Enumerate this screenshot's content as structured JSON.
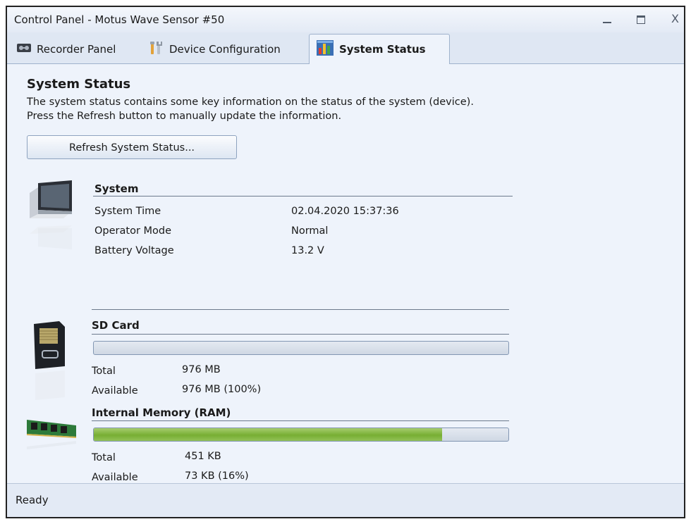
{
  "window": {
    "title": "Control Panel - Motus Wave Sensor #50"
  },
  "window_controls": {
    "minimize": "minimize",
    "maximize": "maximize",
    "close": "X"
  },
  "tabs": [
    {
      "label": "Recorder Panel",
      "icon": "recorder-icon"
    },
    {
      "label": "Device Configuration",
      "icon": "tools-icon"
    },
    {
      "label": "System Status",
      "icon": "system-status-icon",
      "active": true
    }
  ],
  "page": {
    "heading": "System Status",
    "description": [
      "The system status contains some key information on the status of the system (device).",
      "Press the Refresh button to manually update the information."
    ],
    "refresh_button": "Refresh System Status..."
  },
  "system": {
    "title": "System",
    "icon": "monitor-icon",
    "rows": [
      {
        "label": "System Time",
        "value": "02.04.2020 15:37:36"
      },
      {
        "label": "Operator Mode",
        "value": "Normal"
      },
      {
        "label": "Battery Voltage",
        "value": "13.2 V"
      }
    ]
  },
  "sd_card": {
    "title": "SD Card",
    "icon": "sd-card-icon",
    "used_fraction": 0.0,
    "total_label": "Total",
    "total_value": "976 MB",
    "available_label": "Available",
    "available_value": "976 MB (100%)"
  },
  "ram": {
    "title": "Internal Memory (RAM)",
    "icon": "ram-module-icon",
    "used_fraction": 0.84,
    "total_label": "Total",
    "total_value": "451 KB",
    "available_label": "Available",
    "available_value": "73 KB (16%)"
  },
  "colors": {
    "progress_fill": "#77ae33",
    "background": "#eef3fb",
    "progress_track": "#cfd8e4"
  },
  "status": {
    "text": "Ready"
  }
}
